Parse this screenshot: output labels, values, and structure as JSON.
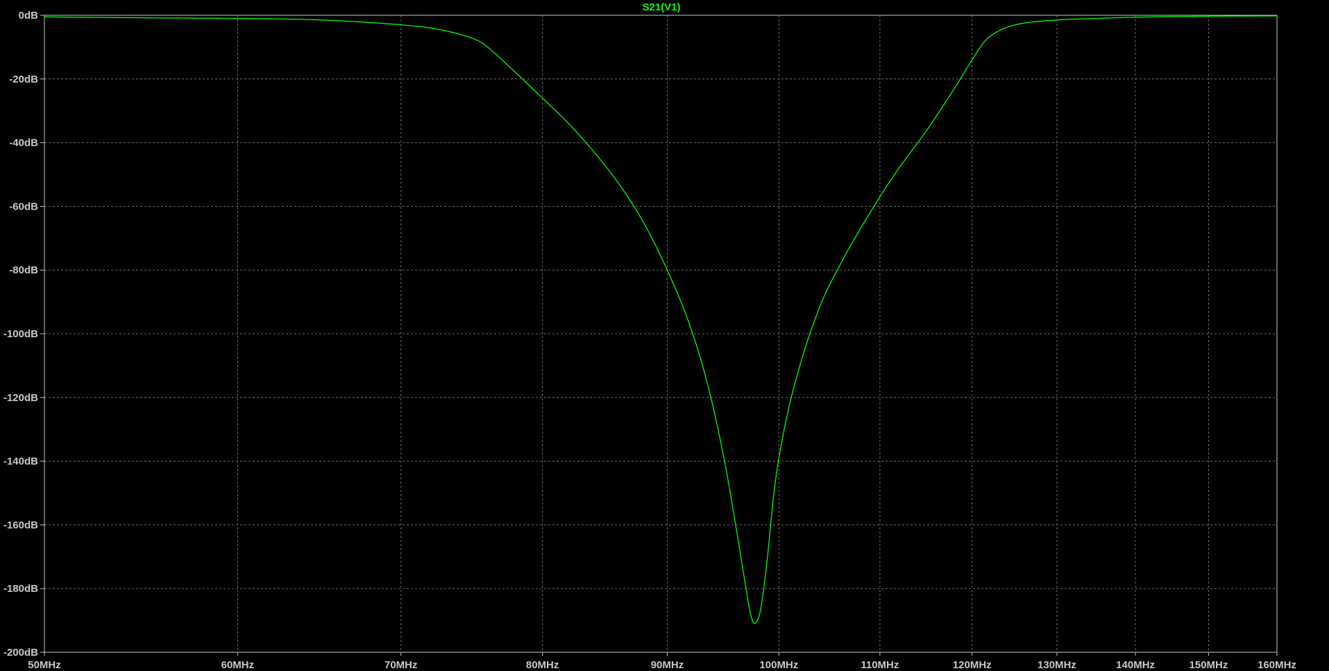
{
  "chart_data": {
    "type": "line",
    "title": "S21(V1)",
    "xscale": "log",
    "xlim_MHz": [
      50,
      160
    ],
    "ylim_dB": [
      -200,
      0
    ],
    "grid": true,
    "x_ticks": [
      {
        "value": 50,
        "label": "50MHz"
      },
      {
        "value": 60,
        "label": "60MHz"
      },
      {
        "value": 70,
        "label": "70MHz"
      },
      {
        "value": 80,
        "label": "80MHz"
      },
      {
        "value": 90,
        "label": "90MHz"
      },
      {
        "value": 100,
        "label": "100MHz"
      },
      {
        "value": 110,
        "label": "110MHz"
      },
      {
        "value": 120,
        "label": "120MHz"
      },
      {
        "value": 130,
        "label": "130MHz"
      },
      {
        "value": 140,
        "label": "140MHz"
      },
      {
        "value": 150,
        "label": "150MHz"
      },
      {
        "value": 160,
        "label": "160MHz"
      }
    ],
    "y_ticks": [
      {
        "value": 0,
        "label": "0dB"
      },
      {
        "value": -20,
        "label": "-20dB"
      },
      {
        "value": -40,
        "label": "-40dB"
      },
      {
        "value": -60,
        "label": "-60dB"
      },
      {
        "value": -80,
        "label": "-80dB"
      },
      {
        "value": -100,
        "label": "-100dB"
      },
      {
        "value": -120,
        "label": "-120dB"
      },
      {
        "value": -140,
        "label": "-140dB"
      },
      {
        "value": -160,
        "label": "-160dB"
      },
      {
        "value": -180,
        "label": "-180dB"
      },
      {
        "value": -200,
        "label": "-200dB"
      }
    ],
    "series": [
      {
        "name": "S21(V1)",
        "color": "#00ff00",
        "x_MHz": [
          50,
          55,
          60,
          65,
          70,
          72,
          74,
          75.5,
          76.5,
          77.5,
          78.5,
          80,
          82,
          84,
          86,
          88,
          90,
          92,
          93.5,
          95,
          96,
          96.8,
          97.3,
          97.7,
          98.2,
          98.8,
          99.6,
          100.5,
          102,
          104,
          106,
          108,
          110,
          112,
          115,
          118,
          120,
          121.5,
          123,
          125,
          130,
          135,
          140,
          150,
          160
        ],
        "y_dB": [
          -0.5,
          -0.8,
          -1,
          -1.5,
          -3,
          -4,
          -6,
          -8.5,
          -12,
          -16,
          -20,
          -26,
          -34,
          -43,
          -53,
          -65,
          -80,
          -98,
          -116,
          -140,
          -160,
          -177,
          -187,
          -191,
          -188,
          -174,
          -148,
          -130,
          -110,
          -91,
          -78,
          -67,
          -57,
          -48,
          -36,
          -23,
          -14,
          -8,
          -5,
          -3,
          -1.5,
          -1,
          -0.6,
          -0.3,
          -0.2
        ]
      }
    ]
  },
  "colors": {
    "background": "#000000",
    "axis": "#c8c8c8",
    "grid": "#6e6e6e",
    "trace": "#00ff00"
  }
}
